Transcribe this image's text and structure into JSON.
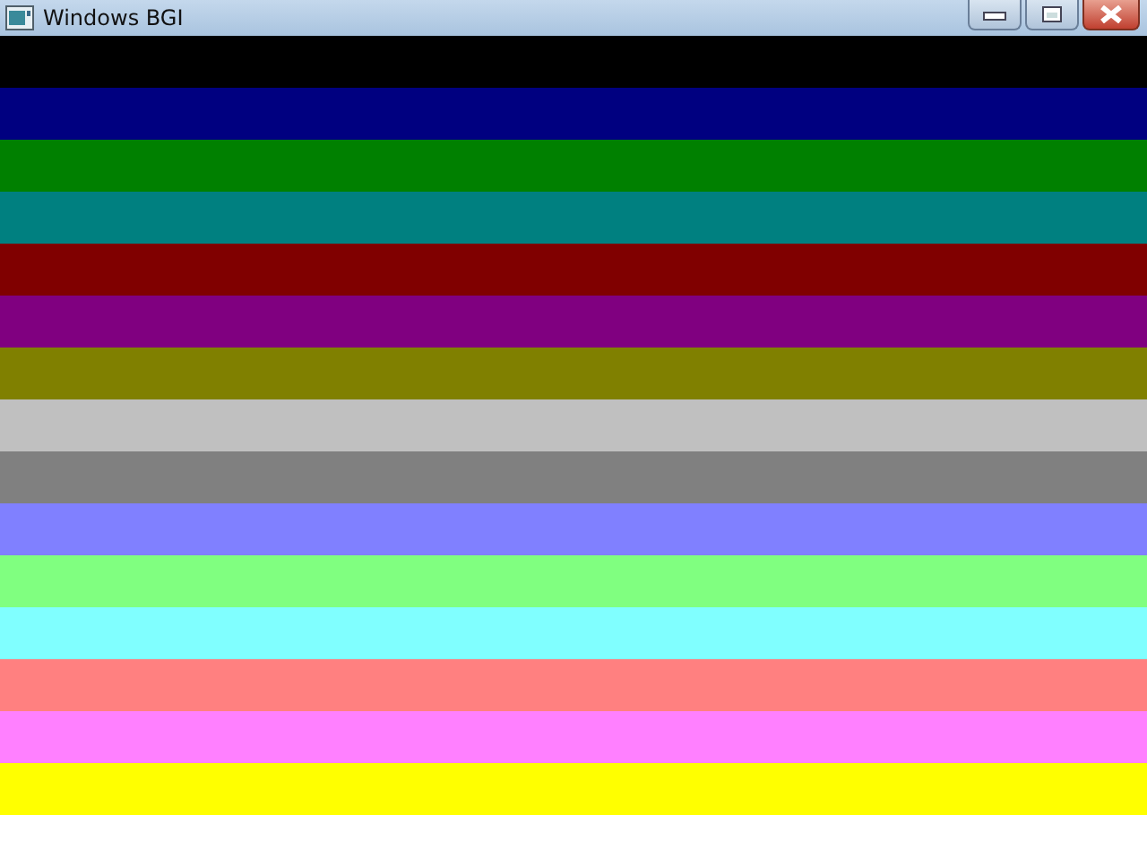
{
  "window": {
    "title": "Windows BGI"
  },
  "bands": [
    {
      "color": "#000000"
    },
    {
      "color": "#000080"
    },
    {
      "color": "#008000"
    },
    {
      "color": "#008080"
    },
    {
      "color": "#800000"
    },
    {
      "color": "#800080"
    },
    {
      "color": "#808000"
    },
    {
      "color": "#c0c0c0"
    },
    {
      "color": "#808080"
    },
    {
      "color": "#8080ff"
    },
    {
      "color": "#80ff80"
    },
    {
      "color": "#80ffff"
    },
    {
      "color": "#ff8080"
    },
    {
      "color": "#ff80ff"
    },
    {
      "color": "#ffff00"
    },
    {
      "color": "#ffffff"
    }
  ]
}
